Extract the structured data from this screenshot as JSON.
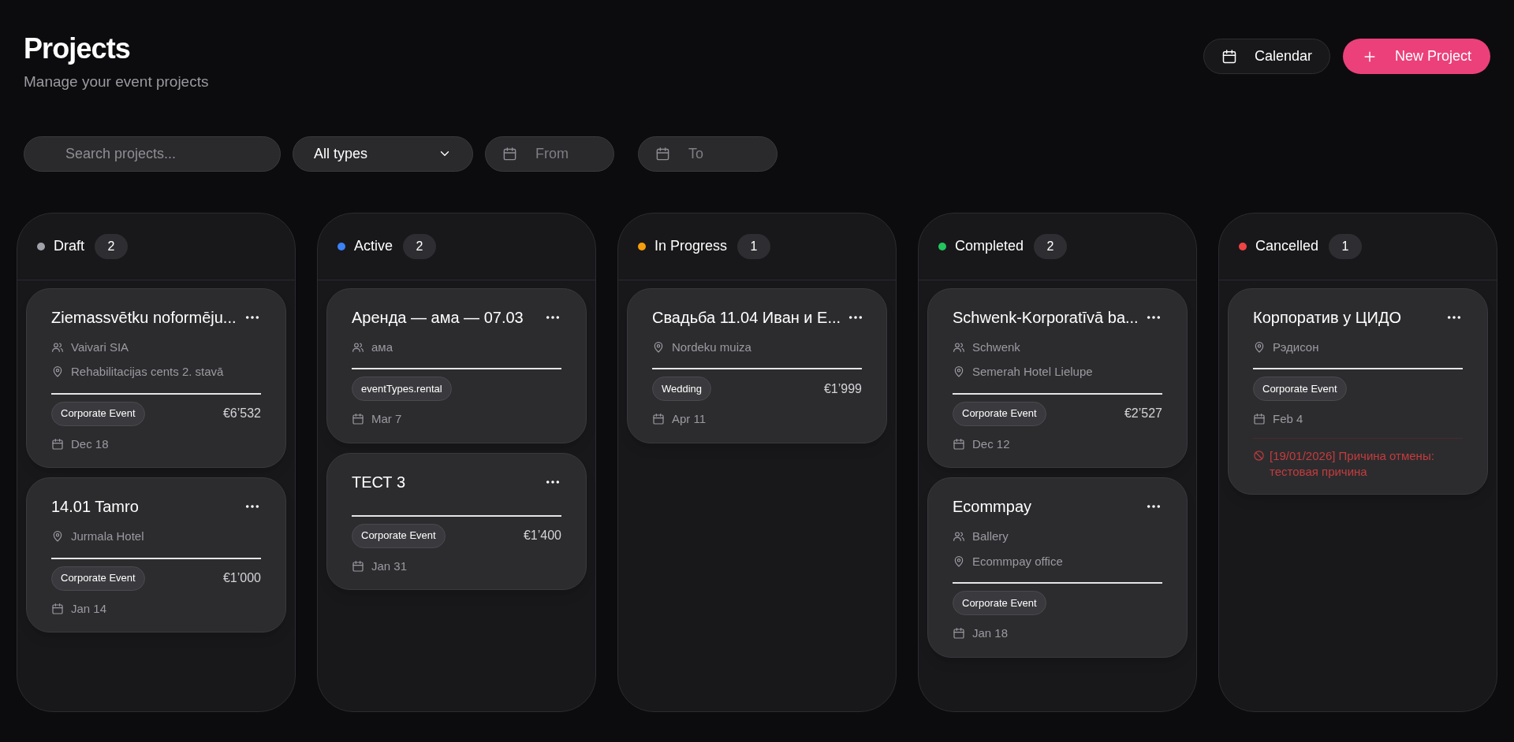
{
  "header": {
    "title": "Projects",
    "subtitle": "Manage your event projects"
  },
  "actions": [
    {
      "kind": "calendar",
      "label": "Calendar"
    },
    {
      "kind": "new",
      "label": "New Project"
    }
  ],
  "filters": {
    "search": {
      "placeholder": "Search projects..."
    },
    "type": {
      "value": "All types"
    },
    "from": {
      "placeholder": "From"
    },
    "to": {
      "placeholder": "To"
    }
  },
  "columns": [
    {
      "name": "Draft",
      "color": "#a1a1aa",
      "count": "2",
      "cards": [
        {
          "title": "Ziemassvētku noformēju...",
          "client": "Vaivari SIA",
          "location": "Rehabilitacijas cents 2. stavā",
          "tag": "Corporate Event",
          "price": "€6’532",
          "date": "Dec 18"
        },
        {
          "title": "14.01 Tamro",
          "location": "Jurmala Hotel",
          "tag": "Corporate Event",
          "price": "€1’000",
          "date": "Jan 14"
        }
      ]
    },
    {
      "name": "Active",
      "color": "#3b82f6",
      "count": "2",
      "cards": [
        {
          "title": "Аренда — ама — 07.03",
          "client": "ама",
          "tag": "eventTypes.rental",
          "date": "Mar 7"
        },
        {
          "title": "ТЕСТ 3",
          "tag": "Corporate Event",
          "price": "€1’400",
          "date": "Jan 31"
        }
      ]
    },
    {
      "name": "In Progress",
      "color": "#f59e0b",
      "count": "1",
      "cards": [
        {
          "title": "Свадьба 11.04 Иван и Е...",
          "location": "Nordeku muiza",
          "tag": "Wedding",
          "price": "€1’999",
          "date": "Apr 11"
        }
      ]
    },
    {
      "name": "Completed",
      "color": "#22c55e",
      "count": "2",
      "cards": [
        {
          "title": "Schwenk-Korporatīvā ba...",
          "client": "Schwenk",
          "location": "Semerah Hotel Lielupe",
          "tag": "Corporate Event",
          "price": "€2’527",
          "date": "Dec 12"
        },
        {
          "title": "Ecommpay",
          "client": "Ballery",
          "location": "Ecommpay office",
          "tag": "Corporate Event",
          "date": "Jan 18"
        }
      ]
    },
    {
      "name": "Cancelled",
      "color": "#ef4444",
      "count": "1",
      "cards": [
        {
          "title": "Корпоратив у ЦИДО",
          "location": "Рэдисон",
          "tag": "Corporate Event",
          "date": "Feb 4",
          "cancel_note": "[19/01/2026] Причина отмены: тестовая причина"
        }
      ]
    }
  ]
}
